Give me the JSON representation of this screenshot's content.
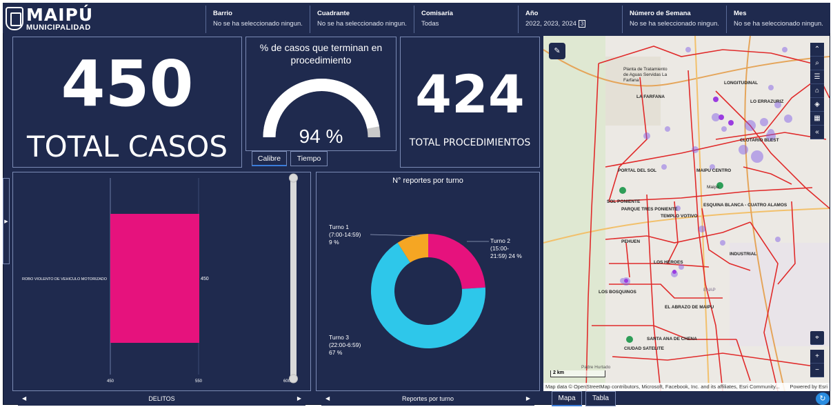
{
  "header": {
    "logo_main": "MAIPÚ",
    "logo_sub": "MUNICIPALIDAD",
    "filters": [
      {
        "label": "Barrio",
        "value": "No se ha seleccionado ningun..."
      },
      {
        "label": "Cuadrante",
        "value": "No se ha seleccionado ningun..."
      },
      {
        "label": "Comisaría",
        "value": "Todas"
      },
      {
        "label": "Año",
        "value": "2022, 2023, 2024",
        "badge": "3"
      },
      {
        "label": "Número de Semana",
        "value": "No se ha seleccionado ningun..."
      },
      {
        "label": "Mes",
        "value": "No se ha seleccionado ningun..."
      }
    ]
  },
  "total_casos": {
    "value": "450",
    "label": "TOTAL CASOS"
  },
  "gauge": {
    "title_line1": "% de casos que terminan en",
    "title_line2": "procedimiento",
    "value_text": "94 %",
    "fraction": 0.94,
    "tabs": [
      "Calibre",
      "Tiempo"
    ]
  },
  "total_procedimientos": {
    "value": "424",
    "label": "TOTAL PROCEDIMIENTOS"
  },
  "delitos": {
    "footer": "DELITOS",
    "category_label": "ROBO VIOLENTO DE VEHICULO MOTORIZADO",
    "value_label": "450",
    "ticks": [
      "450",
      "550",
      "600"
    ]
  },
  "turnos": {
    "title": "N° reportes por turno",
    "footer": "Reportes por turno",
    "labels": [
      {
        "l1": "Turno 1",
        "l2": "(7:00-14:59)",
        "l3": "9 %"
      },
      {
        "l1": "Turno 2",
        "l2": "(15:00-",
        "l3": "21:59) 24 %"
      },
      {
        "l1": "Turno 3",
        "l2": "(22:00-6:59)",
        "l3": "67 %"
      }
    ]
  },
  "chart_data": [
    {
      "type": "bar",
      "orientation": "horizontal",
      "categories": [
        "ROBO VIOLENTO DE VEHICULO MOTORIZADO"
      ],
      "values": [
        450
      ],
      "xlabel": "DELITOS",
      "xlim": [
        400,
        600
      ],
      "ticks": [
        450,
        550,
        600
      ]
    },
    {
      "type": "pie",
      "title": "N° reportes por turno",
      "categories": [
        "Turno 1 (7:00-14:59)",
        "Turno 2 (15:00-21:59)",
        "Turno 3 (22:00-6:59)"
      ],
      "values": [
        9,
        24,
        67
      ],
      "colors": [
        "#f5a623",
        "#e6127d",
        "#2ec7ea"
      ]
    }
  ],
  "map": {
    "attribution": "Map data © OpenStreetMap contributors, Microsoft, Facebook, Inc. and its affiliates, Esri Community...",
    "powered": "Powered by Esri",
    "scale": "2 km",
    "labels": [
      "LONGITUDINAL",
      "LA FARFANA",
      "LO ERRAZURIZ",
      "CLOTARIO BLEST",
      "PORTAL DEL SOL",
      "MAIPU CENTRO",
      "SOL PONIENTE",
      "PARQUE TRES PONIENTE",
      "ESQUINA BLANCA - CUATRO ALAMOS",
      "TEMPLO VOTIVO",
      "PEHUEN",
      "INDUSTRIAL",
      "LOS HEROES",
      "LOS BOSQUINOS",
      "EL ABRAZO DE MAIPU",
      "SANTA ANA DE CHENA",
      "CIUDAD SATELITE",
      "Maipú",
      "Planta de Tratamiento de Aguas Servidas La Farfana",
      "ENAP",
      "Padre Hurtado"
    ],
    "tabs": [
      "Mapa",
      "Tabla"
    ]
  },
  "colors": {
    "navy": "#1f2a4e",
    "pink": "#e6127d",
    "cyan": "#2ec7ea",
    "orange": "#f5a623",
    "gauge_fill": "#ffffff",
    "gauge_empty": "#c9c9c9"
  }
}
